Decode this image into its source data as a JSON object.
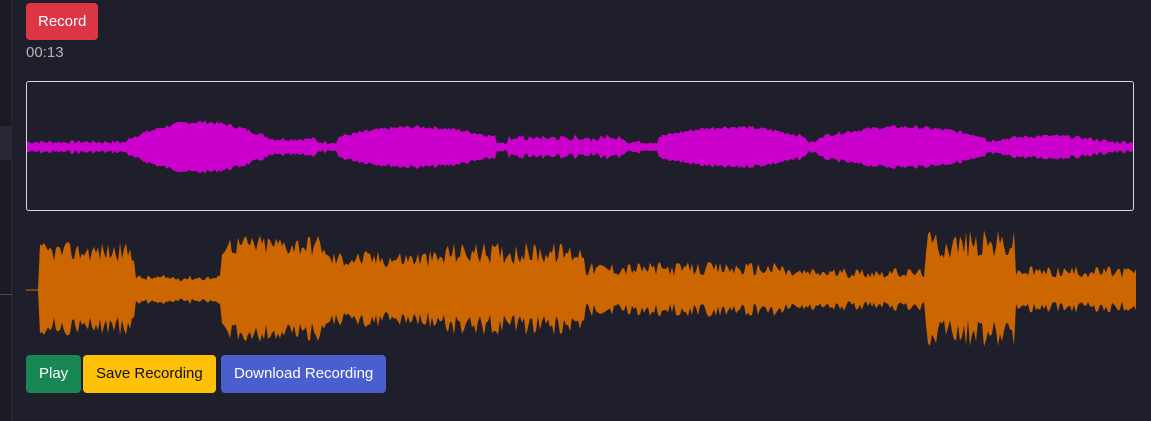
{
  "recorder": {
    "record_label": "Record",
    "elapsed_time": "00:13"
  },
  "waveform": {
    "color": "#cc00cc",
    "border_color": "#d8d8e0"
  },
  "live_waveform": {
    "color": "#cc6600"
  },
  "actions": {
    "play_label": "Play",
    "save_label": "Save Recording",
    "download_label": "Download Recording"
  },
  "colors": {
    "background": "#1f1f2b",
    "record": "#dc3545",
    "play": "#198754",
    "save": "#ffc107",
    "download": "#4a5fcf"
  }
}
